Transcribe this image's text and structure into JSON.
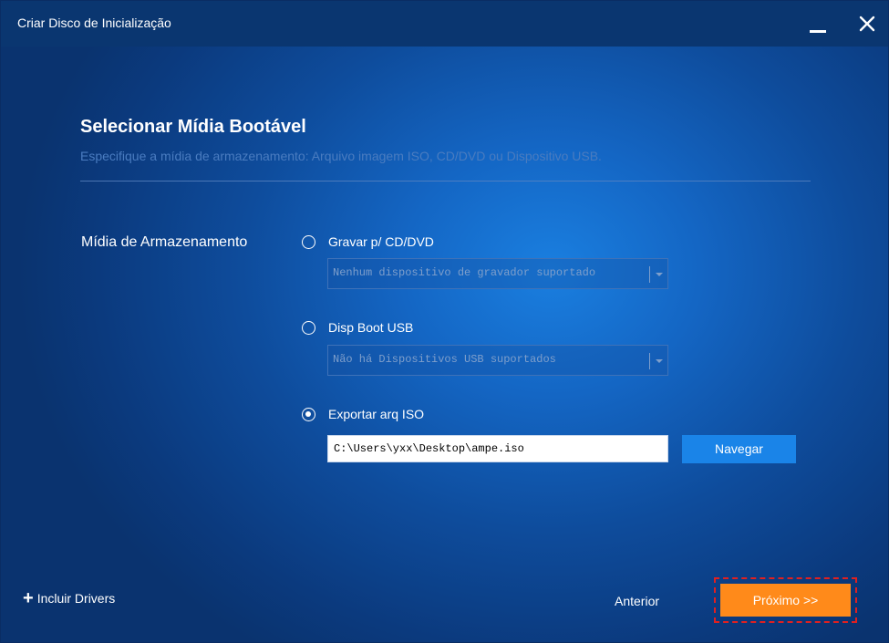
{
  "window": {
    "title": "Criar Disco de Inicialização"
  },
  "header": {
    "heading": "Selecionar Mídia Bootável",
    "subheading": "Especifique a mídia de armazenamento: Arquivo imagem ISO, CD/DVD ou Dispositivo USB."
  },
  "media": {
    "label": "Mídia de Armazenamento",
    "options": [
      {
        "label": "Gravar p/ CD/DVD",
        "checked": false,
        "select_value": "Nenhum dispositivo de gravador suportado"
      },
      {
        "label": "Disp Boot USB",
        "checked": false,
        "select_value": "Não há Dispositivos USB suportados"
      },
      {
        "label": "Exportar arq ISO",
        "checked": true,
        "path_value": "C:\\Users\\yxx\\Desktop\\ampe.iso"
      }
    ],
    "browse_label": "Navegar"
  },
  "footer": {
    "include_drivers_label": "Incluir Drivers",
    "prev_label": "Anterior",
    "next_label": "Próximo >>"
  },
  "colors": {
    "accent": "#1a84e8",
    "next_button": "#ff8a1a",
    "highlight_border": "#e02020"
  }
}
